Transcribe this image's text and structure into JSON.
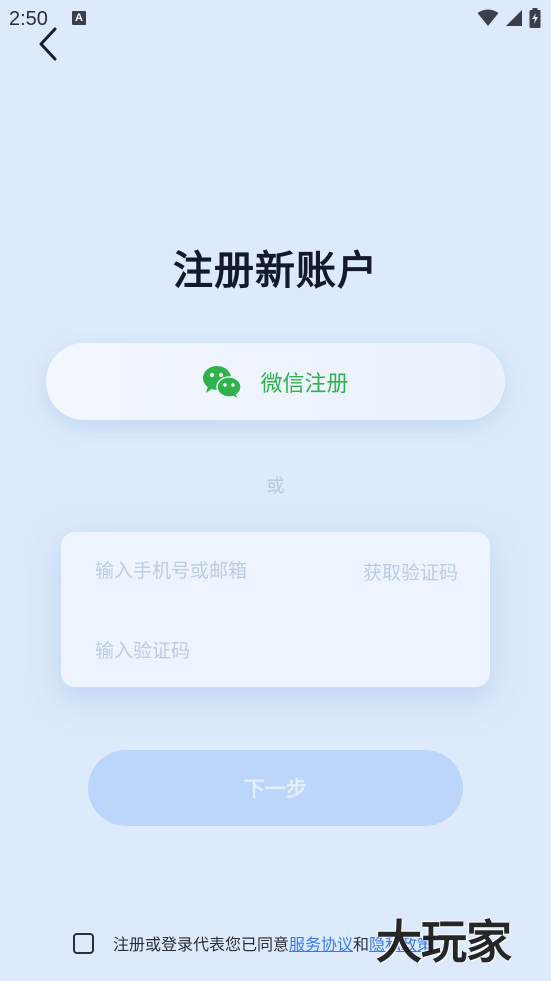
{
  "status_bar": {
    "time": "2:50",
    "notification_icon": "a-notification-icon",
    "icons": [
      "wifi-icon",
      "signal-icon",
      "battery-charging-icon"
    ]
  },
  "header": {
    "back_icon": "chevron-left-icon",
    "title": "注册新账户"
  },
  "wechat_register": {
    "icon": "wechat-icon",
    "label": "微信注册",
    "color": "#2fb14b"
  },
  "divider": {
    "label": "或"
  },
  "form": {
    "account": {
      "placeholder": "输入手机号或邮箱",
      "value": ""
    },
    "get_code_label": "获取验证码",
    "code": {
      "placeholder": "输入验证码",
      "value": ""
    }
  },
  "next_button": {
    "label": "下一步",
    "color": "#bcd6fb"
  },
  "agreement": {
    "checked": false,
    "text_prefix": "注册或登录代表您已同意",
    "service_link": "服务协议",
    "conjunction": "和",
    "privacy_link": "隐私政策"
  },
  "watermark": {
    "text": "大玩家"
  },
  "colors": {
    "background": "#dceafb",
    "link": "#3a7be8",
    "title": "#141a2e"
  }
}
